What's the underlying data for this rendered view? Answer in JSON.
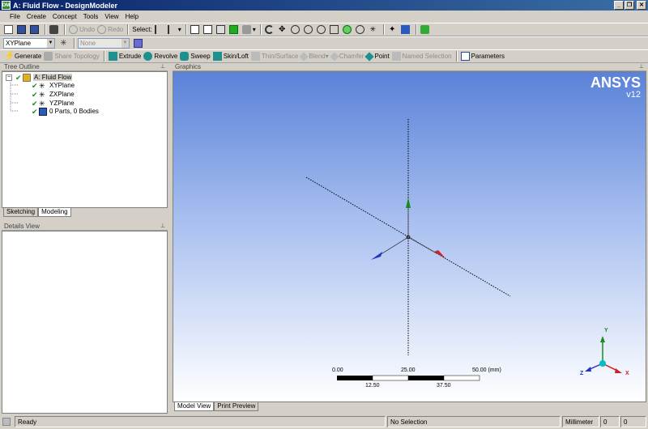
{
  "titlebar": {
    "title": "A: Fluid Flow - DesignModeler",
    "logo_text": "DM"
  },
  "menu": [
    "File",
    "Create",
    "Concept",
    "Tools",
    "View",
    "Help"
  ],
  "toolbar1": {
    "undo_label": "Undo",
    "redo_label": "Redo",
    "select_label": "Select:"
  },
  "toolbar2": {
    "plane_value": "XYPlane",
    "sketch_value": "None"
  },
  "toolbar3": {
    "generate": "Generate",
    "share_topology": "Share Topology",
    "extrude": "Extrude",
    "revolve": "Revolve",
    "sweep": "Sweep",
    "skin_loft": "Skin/Loft",
    "thin_surface": "Thin/Surface",
    "blend": "Blend",
    "chamfer": "Chamfer",
    "point": "Point",
    "named_selection": "Named Selection",
    "parameters": "Parameters"
  },
  "tree_outline": {
    "header": "Tree Outline",
    "root": "A: Fluid Flow",
    "items": [
      "XYPlane",
      "ZXPlane",
      "YZPlane",
      "0 Parts, 0 Bodies"
    ]
  },
  "tabs": [
    "Sketching",
    "Modeling"
  ],
  "details": {
    "header": "Details View"
  },
  "graphics": {
    "header": "Graphics",
    "brand": "ANSYS",
    "version": "v12",
    "scale_top": [
      "0.00",
      "25.00",
      "50.00 (mm)"
    ],
    "scale_bottom": [
      "12.50",
      "37.50"
    ],
    "triad_labels": [
      "Y",
      "Z",
      "X"
    ],
    "view_tabs": [
      "Model View",
      "Print Preview"
    ]
  },
  "status": {
    "ready": "Ready",
    "selection": "No Selection",
    "units": "Millimeter",
    "val1": "0",
    "val2": "0"
  },
  "colors": {
    "x_axis": "#cc2222",
    "y_axis": "#1a8a1a",
    "z_axis": "#2233cc",
    "bg_top": "#5a82d8"
  }
}
